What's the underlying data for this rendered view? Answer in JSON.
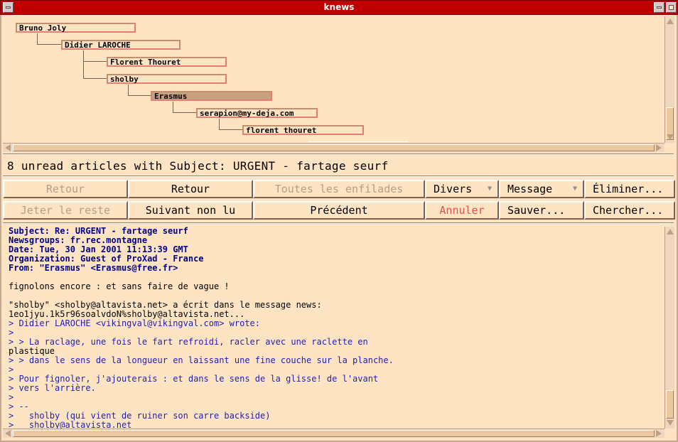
{
  "window": {
    "title": "knews"
  },
  "thread_tree": {
    "nodes": [
      {
        "label": "Bruno Joly",
        "selected": false
      },
      {
        "label": "Didier LAROCHE",
        "selected": false
      },
      {
        "label": "Florent Thouret",
        "selected": false
      },
      {
        "label": "sholby",
        "selected": false
      },
      {
        "label": "Erasmus",
        "selected": true
      },
      {
        "label": "serapion@my-deja.com",
        "selected": false
      },
      {
        "label": "florent thouret",
        "selected": false
      }
    ]
  },
  "status": {
    "text": "8 unread articles with Subject: URGENT - fartage seurf"
  },
  "buttons": {
    "row1": [
      {
        "label": "Retour",
        "state": "disabled"
      },
      {
        "label": "Retour",
        "state": "normal"
      },
      {
        "label": "Toutes les enfilades",
        "state": "disabled"
      },
      {
        "label": "Divers",
        "state": "menu"
      },
      {
        "label": "Message",
        "state": "menu"
      },
      {
        "label": "Éliminer...",
        "state": "normal"
      }
    ],
    "row2": [
      {
        "label": "Jeter le reste",
        "state": "disabled"
      },
      {
        "label": "Suivant non lu",
        "state": "normal"
      },
      {
        "label": "Précédent",
        "state": "normal"
      },
      {
        "label": "Annuler",
        "state": "red"
      },
      {
        "label": "Sauver...",
        "state": "normal"
      },
      {
        "label": "Chercher...",
        "state": "normal"
      }
    ],
    "dropdown_glyph": "▼"
  },
  "article": {
    "headers": [
      "Subject: Re: URGENT - fartage seurf",
      "Newsgroups: fr.rec.montagne",
      "Date: Tue, 30 Jan 2001 11:13:39 GMT",
      "Organization: Guest of ProXad - France",
      "From: \"Erasmus\" <Erasmus@free.fr>"
    ],
    "body_lines": [
      {
        "text": "",
        "quoted": false
      },
      {
        "text": "fignolons encore : et sans faire de vague !",
        "quoted": false
      },
      {
        "text": "",
        "quoted": false
      },
      {
        "text": "\"sholby\" <sholby@altavista.net> a écrit dans le message news:",
        "quoted": false
      },
      {
        "text": "1eo1jyu.1k5r96soalvdoN%sholby@altavista.net...",
        "quoted": false
      },
      {
        "text": "> Didier LAROCHE <vikingval@vikingval.com> wrote:",
        "quoted": true
      },
      {
        "text": ">",
        "quoted": true
      },
      {
        "text": "> > La raclage, une fois le fart refroidi, racler avec une raclette en",
        "quoted": true
      },
      {
        "text": "plastique",
        "quoted": false
      },
      {
        "text": "> > dans le sens de la longueur en laissant une fine couche sur la planche.",
        "quoted": true
      },
      {
        "text": ">",
        "quoted": true
      },
      {
        "text": "> Pour fignoler, j'ajouterais : et dans le sens de la glisse! de l'avant",
        "quoted": true
      },
      {
        "text": "> vers l'arrière.",
        "quoted": true
      },
      {
        "text": ">",
        "quoted": true
      },
      {
        "text": "> --",
        "quoted": true
      },
      {
        "text": ">   sholby (qui vient de ruiner son carre backside)",
        "quoted": true
      },
      {
        "text": ">   sholby@altavista.net",
        "quoted": true
      }
    ]
  },
  "colors": {
    "titlebar": "#c00000",
    "background": "#ffe4c4",
    "header_text": "#00008b",
    "quote_text": "#1f1fb0",
    "cancel_text": "#e05050"
  }
}
